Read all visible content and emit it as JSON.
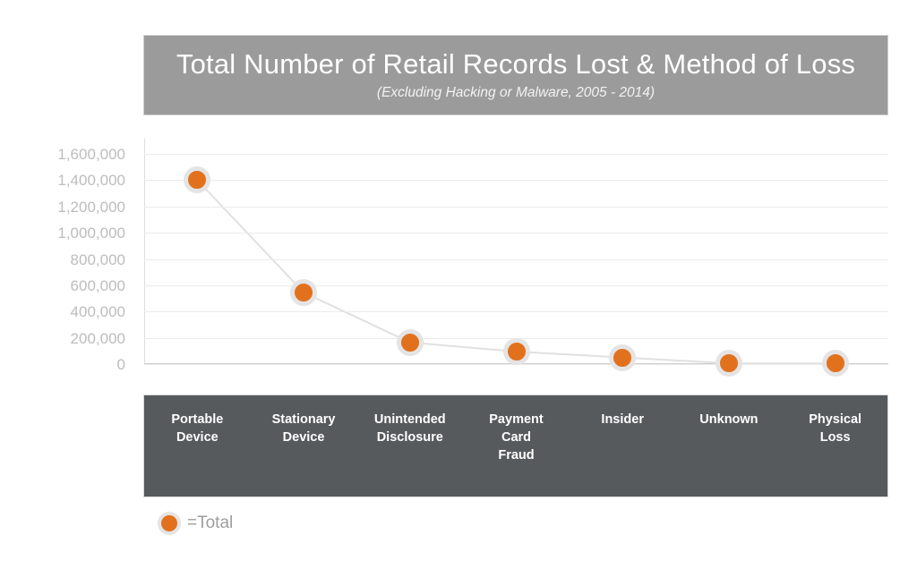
{
  "header": {
    "title": "Total Number of Retail Records Lost & Method of Loss",
    "subtitle": "(Excluding Hacking or Malware, 2005 - 2014)"
  },
  "legend": {
    "label": "=Total",
    "marker_icon": "circle-marker-icon"
  },
  "colors": {
    "marker": "#E2711D",
    "marker_ring": "#E4E4E4",
    "title_band": "#9B9B9B",
    "category_band": "#565A5C",
    "gridline": "#EBEBEB",
    "tick_text": "#BDBDBD",
    "legend_text": "#9E9E9E"
  },
  "chart_data": {
    "type": "line",
    "title": "Total Number of Retail Records Lost & Method of Loss",
    "subtitle": "(Excluding Hacking or Malware, 2005 - 2014)",
    "xlabel": "",
    "ylabel": "",
    "categories": [
      "Portable Device",
      "Stationary Device",
      "Unintended Disclosure",
      "Payment Card Fraud",
      "Insider",
      "Unknown",
      "Physical Loss"
    ],
    "category_lines": [
      [
        "Portable",
        "Device"
      ],
      [
        "Stationary",
        "Device"
      ],
      [
        "Unintended",
        "Disclosure"
      ],
      [
        "Payment",
        "Card",
        "Fraud"
      ],
      [
        "Insider"
      ],
      [
        "Unknown"
      ],
      [
        "Physical",
        "Loss"
      ]
    ],
    "series": [
      {
        "name": "Total",
        "values": [
          1400000,
          545000,
          165000,
          95000,
          50000,
          6000,
          4000
        ]
      }
    ],
    "ylim": [
      0,
      1600000
    ],
    "ytick_values": [
      1600000,
      1400000,
      1200000,
      1000000,
      800000,
      600000,
      400000,
      200000,
      0
    ],
    "ytick_labels": [
      "1,600,000",
      "1,400,000",
      "1,200,000",
      "1,000,000",
      "800,000",
      "600,000",
      "400,000",
      "200,000",
      "0"
    ],
    "grid": true,
    "legend_position": "bottom-left",
    "marker_shape": "circle"
  }
}
